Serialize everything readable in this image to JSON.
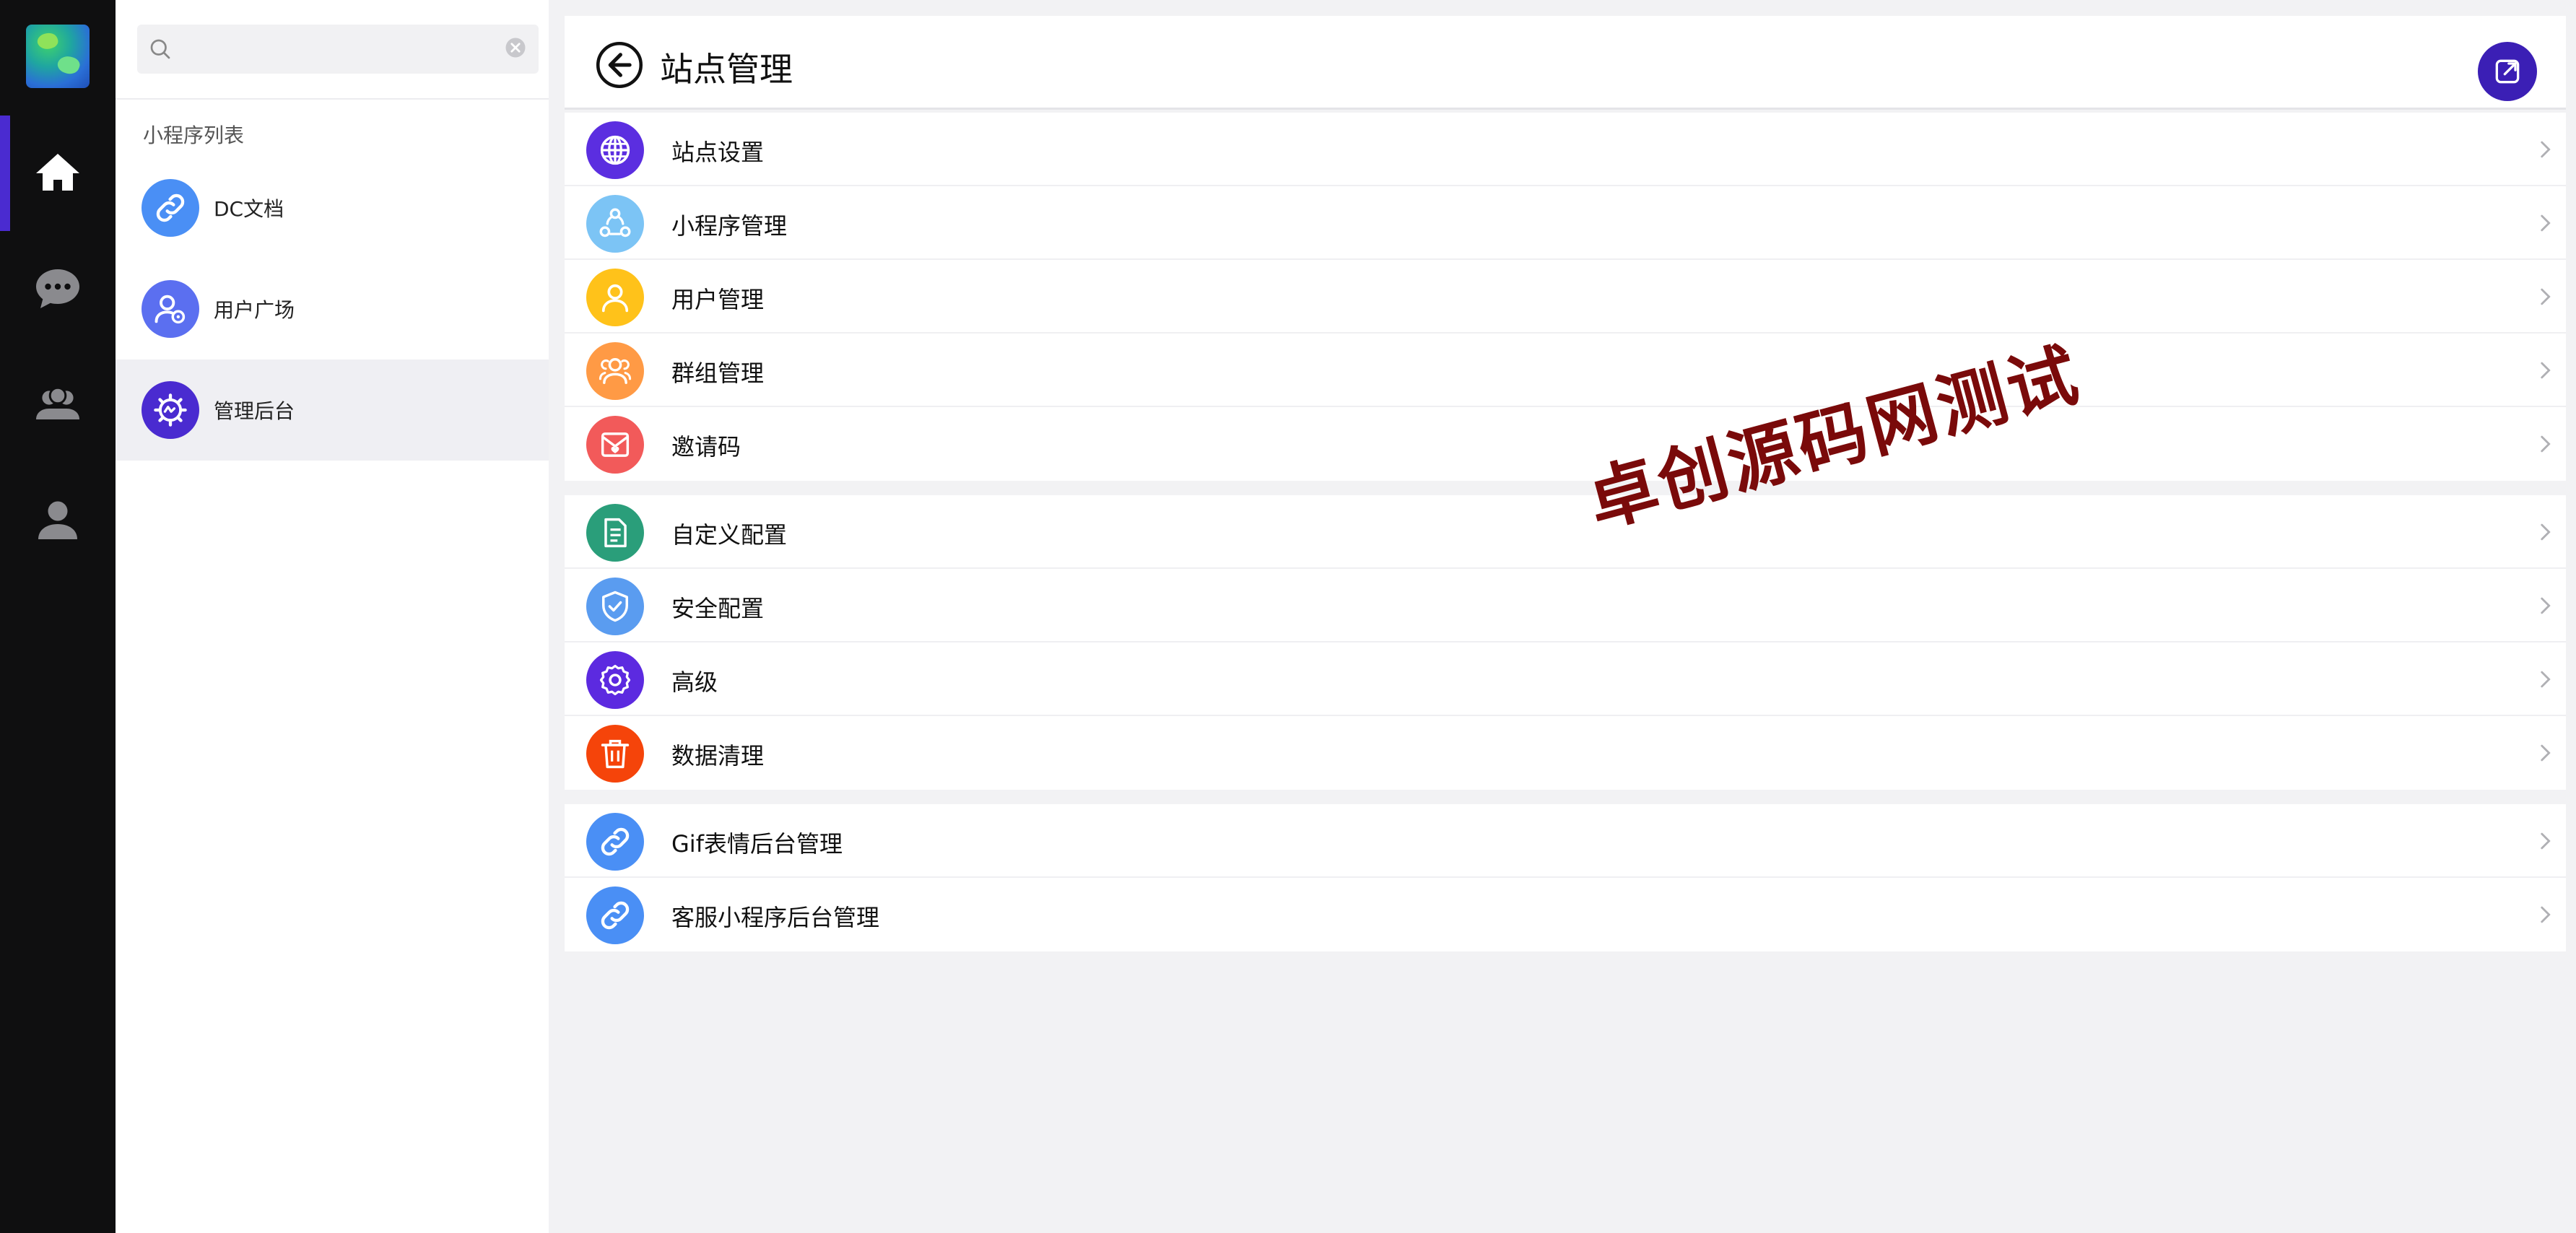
{
  "sidebar": {
    "search": {
      "value": "",
      "placeholder": ""
    },
    "section_title": "小程序列表",
    "items": [
      {
        "label": "DC文档",
        "icon": "link-icon",
        "color": "#4a8ff5"
      },
      {
        "label": "用户广场",
        "icon": "user-square-icon",
        "color": "#5b6ff0"
      },
      {
        "label": "管理后台",
        "icon": "admin-gear-icon",
        "color": "#4a2bd0"
      }
    ]
  },
  "header": {
    "title": "站点管理"
  },
  "groups": [
    {
      "rows": [
        {
          "label": "站点设置",
          "icon": "globe-icon",
          "color": "#5b2ee0"
        },
        {
          "label": "小程序管理",
          "icon": "nodes-icon",
          "color": "#7cc4f5"
        },
        {
          "label": "用户管理",
          "icon": "user-icon",
          "color": "#ffc21a"
        },
        {
          "label": "群组管理",
          "icon": "group-icon",
          "color": "#ff9a45"
        },
        {
          "label": "邀请码",
          "icon": "invite-icon",
          "color": "#f25a5a"
        }
      ]
    },
    {
      "rows": [
        {
          "label": "自定义配置",
          "icon": "document-icon",
          "color": "#2a9e7a"
        },
        {
          "label": "安全配置",
          "icon": "shield-icon",
          "color": "#5a9cf0"
        },
        {
          "label": "高级",
          "icon": "gear-icon",
          "color": "#5c2ae0"
        },
        {
          "label": "数据清理",
          "icon": "trash-icon",
          "color": "#f5440a"
        }
      ]
    },
    {
      "rows": [
        {
          "label": "Gif表情后台管理",
          "icon": "link-icon",
          "color": "#4a8ff5"
        },
        {
          "label": "客服小程序后台管理",
          "icon": "link-icon",
          "color": "#4a8ff5"
        }
      ]
    }
  ],
  "watermark": "卓创源码网测试",
  "colors": {
    "accent": "#4a2bd0",
    "rail_bg": "#0f0f10",
    "open_button": "#3b1fb5"
  }
}
